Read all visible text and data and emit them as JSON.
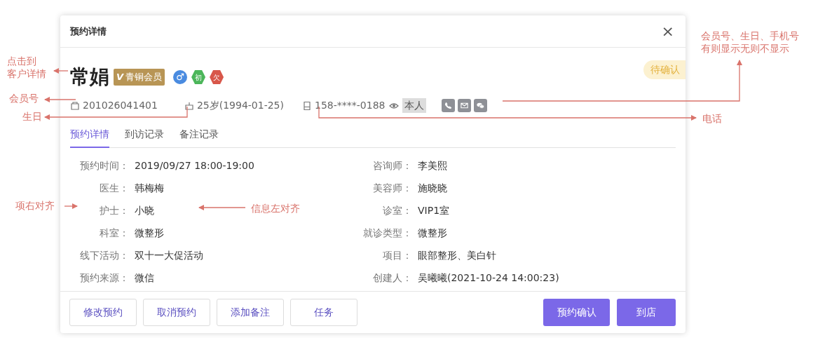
{
  "modal": {
    "title": "预约详情",
    "close": "×"
  },
  "customer": {
    "name": "常娟",
    "member_badge": {
      "mark": "V",
      "label": "青铜会员"
    },
    "tags": [
      {
        "label": "♂",
        "color": "#4a8be0",
        "kind": "circle"
      },
      {
        "label": "初",
        "color": "#4cb65a",
        "kind": "hexagon"
      },
      {
        "label": "欠",
        "color": "#d8574a",
        "kind": "hexagon"
      }
    ],
    "status": "待确认"
  },
  "info": {
    "member_no": "201026041401",
    "birthday": "25岁(1994-01-25)",
    "phone": "158-****-0188",
    "identity": "本人"
  },
  "tabs": [
    {
      "label": "预约详情",
      "selected": true
    },
    {
      "label": "到访记录",
      "selected": false
    },
    {
      "label": "备注记录",
      "selected": false
    }
  ],
  "left_fields": [
    {
      "label": "预约时间：",
      "value": "2019/09/27 18:00-19:00"
    },
    {
      "label": "医生：",
      "value": "韩梅梅"
    },
    {
      "label": "护士：",
      "value": "小晓"
    },
    {
      "label": "科室：",
      "value": "微整形"
    },
    {
      "label": "线下活动：",
      "value": "双十一大促活动"
    },
    {
      "label": "预约来源：",
      "value": "微信"
    }
  ],
  "right_fields": [
    {
      "label": "咨询师：",
      "value": "李美熙"
    },
    {
      "label": "美容师：",
      "value": "施晓晓"
    },
    {
      "label": "诊室：",
      "value": "VIP1室"
    },
    {
      "label": "就诊类型：",
      "value": "微整形"
    },
    {
      "label": "项目：",
      "value": "眼部整形、美白针"
    },
    {
      "label": "创建人：",
      "value": "吴曦曦(2021-10-24 14:00:23)"
    }
  ],
  "buttons": [
    {
      "label": "修改预约",
      "kind": "outline"
    },
    {
      "label": "取消预约",
      "kind": "outline"
    },
    {
      "label": "添加备注",
      "kind": "outline"
    },
    {
      "label": "任务",
      "kind": "outline"
    },
    {
      "label": "预约确认",
      "kind": "primary"
    },
    {
      "label": "到店",
      "kind": "primary"
    }
  ],
  "annotations": [
    {
      "lines": [
        "点击到",
        "客户详情"
      ]
    },
    {
      "lines": [
        "会员号"
      ]
    },
    {
      "lines": [
        "生日"
      ]
    },
    {
      "lines": [
        "会员号、生日、手机号",
        "有则显示无则不显示"
      ]
    },
    {
      "lines": [
        "电话"
      ]
    },
    {
      "lines": [
        "项右对齐"
      ]
    },
    {
      "lines": [
        "信息左对齐"
      ]
    }
  ]
}
